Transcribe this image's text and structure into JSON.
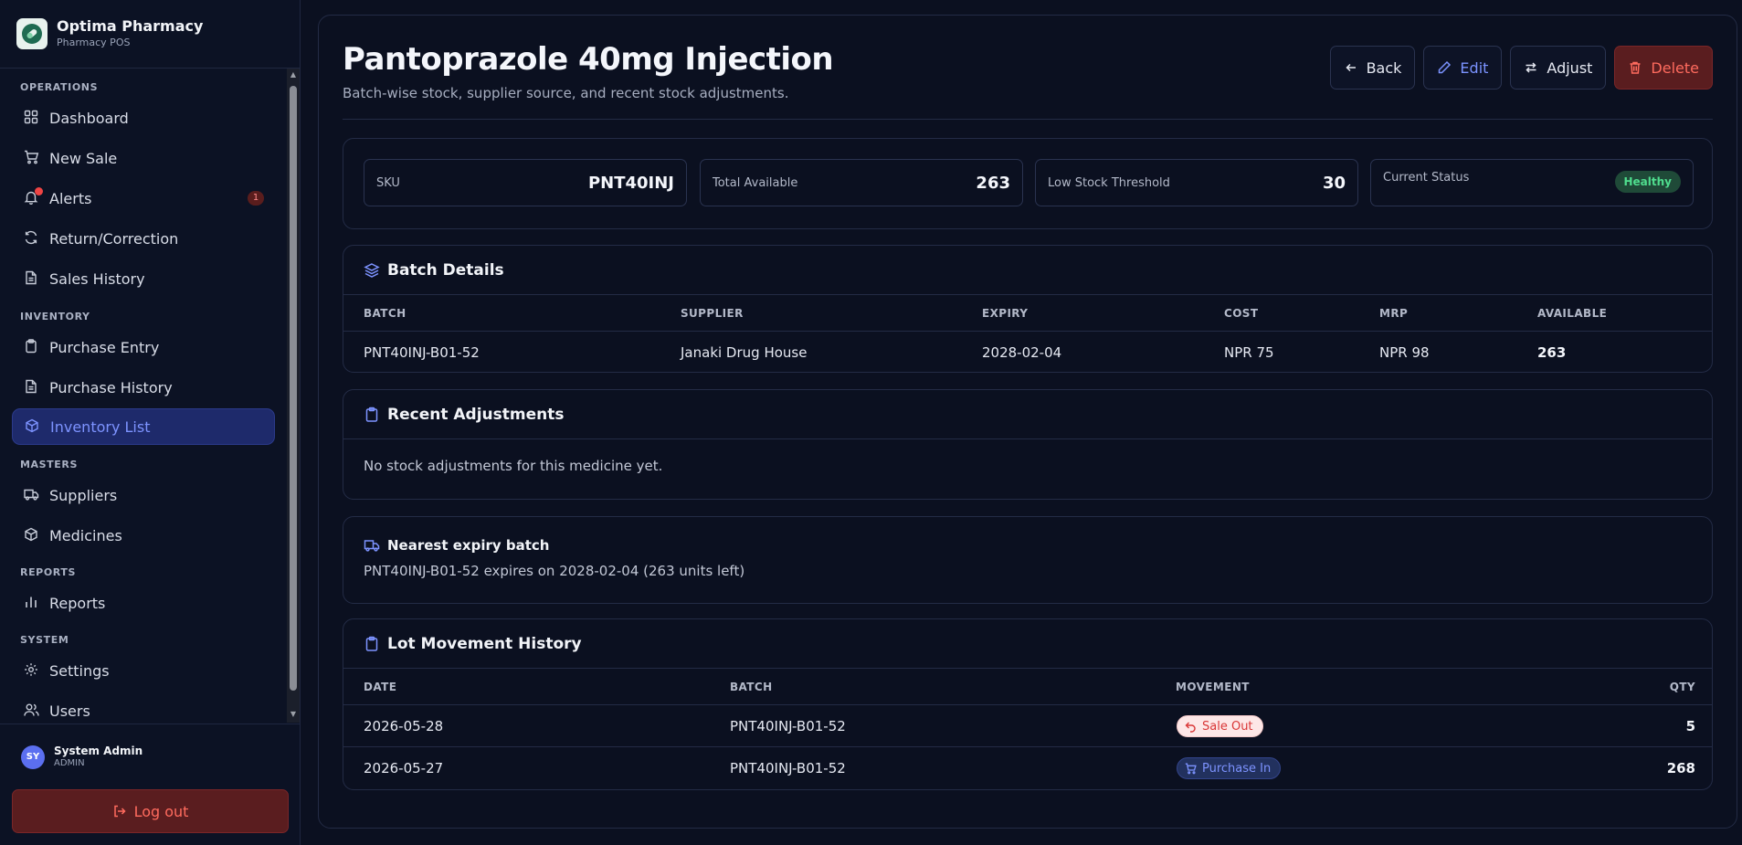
{
  "brand": {
    "name": "Optima Pharmacy",
    "subtitle": "Pharmacy POS"
  },
  "sidebar": {
    "sections": {
      "operations": "OPERATIONS",
      "inventory": "INVENTORY",
      "masters": "MASTERS",
      "reports": "REPORTS",
      "system": "SYSTEM"
    },
    "items": {
      "dashboard": "Dashboard",
      "new_sale": "New Sale",
      "alerts": "Alerts",
      "alerts_count": "1",
      "return_correction": "Return/Correction",
      "sales_history": "Sales History",
      "purchase_entry": "Purchase Entry",
      "purchase_history": "Purchase History",
      "inventory_list": "Inventory List",
      "suppliers": "Suppliers",
      "medicines": "Medicines",
      "reports": "Reports",
      "settings": "Settings",
      "users": "Users"
    },
    "active_item": "inventory_list",
    "user": {
      "initials": "SY",
      "name": "System Admin",
      "role": "ADMIN"
    },
    "logout_label": "Log out"
  },
  "header": {
    "title": "Pantoprazole 40mg Injection",
    "subtitle": "Batch-wise stock, supplier source, and recent stock adjustments.",
    "actions": {
      "back": "Back",
      "edit": "Edit",
      "adjust": "Adjust",
      "delete": "Delete"
    }
  },
  "stats": {
    "sku_label": "SKU",
    "sku_value": "PNT40INJ",
    "total_label": "Total Available",
    "total_value": "263",
    "threshold_label": "Low Stock Threshold",
    "threshold_value": "30",
    "status_label": "Current Status",
    "status_value": "Healthy"
  },
  "batch_details": {
    "title": "Batch Details",
    "columns": [
      "BATCH",
      "SUPPLIER",
      "EXPIRY",
      "COST",
      "MRP",
      "AVAILABLE"
    ],
    "rows": [
      [
        "PNT40INJ-B01-52",
        "Janaki Drug House",
        "2028-02-04",
        "NPR 75",
        "NPR 98",
        "263"
      ]
    ]
  },
  "recent_adjustments": {
    "title": "Recent Adjustments",
    "empty_text": "No stock adjustments for this medicine yet."
  },
  "nearest_expiry": {
    "title": "Nearest expiry batch",
    "text": "PNT40INJ-B01-52 expires on 2028-02-04 (263 units left)"
  },
  "lot_history": {
    "title": "Lot Movement History",
    "columns": [
      "DATE",
      "BATCH",
      "MOVEMENT",
      "QTY"
    ],
    "rows": [
      {
        "date": "2026-05-28",
        "batch": "PNT40INJ-B01-52",
        "movement": "Sale Out",
        "qty": "5"
      },
      {
        "date": "2026-05-27",
        "batch": "PNT40INJ-B01-52",
        "movement": "Purchase In",
        "qty": "268"
      }
    ]
  },
  "colors": {
    "accent": "#7d93ff",
    "danger": "#ff6b5e",
    "success": "#4fdd8e",
    "background": "#0b1020"
  }
}
